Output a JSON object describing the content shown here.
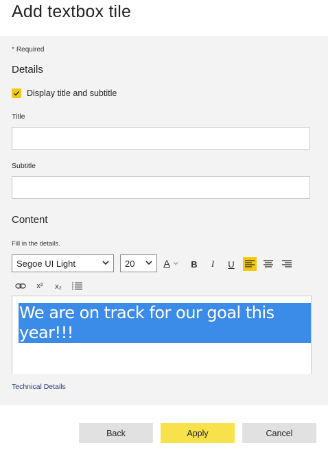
{
  "header": {
    "title": "Add textbox tile"
  },
  "form": {
    "required_label": "Required",
    "details_title": "Details",
    "display_checkbox_label": "Display title and subtitle",
    "title_label": "Title",
    "title_value": "",
    "subtitle_label": "Subtitle",
    "subtitle_value": "",
    "content_title": "Content",
    "hint": "Fill in the details.",
    "font_family": "Segoe UI Light",
    "font_size": "20",
    "editor_text": "We are on track for our goal this year!!!",
    "technical_details_link": "Technical Details"
  },
  "toolbar": {
    "font_color_glyph": "A",
    "bold_glyph": "B",
    "italic_glyph": "I",
    "underline_glyph": "U",
    "superscript_glyph": "x²",
    "subscript_glyph": "x₂",
    "active_alignment": "left"
  },
  "footer": {
    "back_label": "Back",
    "apply_label": "Apply",
    "cancel_label": "Cancel"
  },
  "colors": {
    "accent": "#f2c811",
    "apply_button": "#f8e24b",
    "selection": "#3b8be8",
    "panel_bg": "#f3f3f3"
  }
}
